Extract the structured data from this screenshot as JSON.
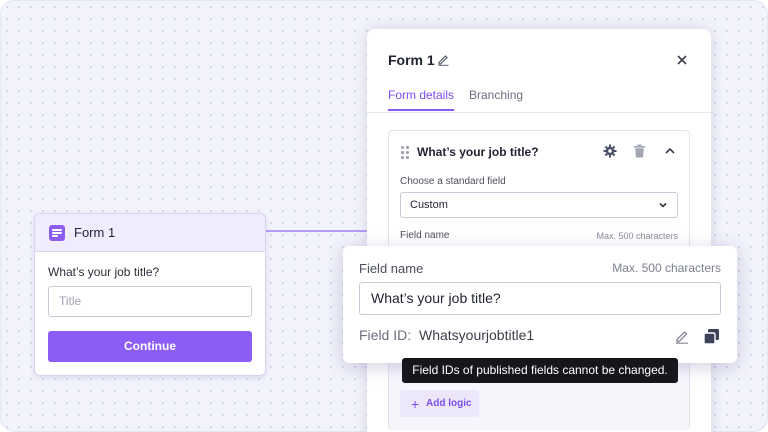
{
  "form_preview": {
    "title": "Form 1",
    "question": "What’s your job title?",
    "input_placeholder": "Title",
    "button_label": "Continue"
  },
  "panel": {
    "title": "Form 1",
    "tabs": [
      {
        "label": "Form details",
        "active": true
      },
      {
        "label": "Branching",
        "active": false
      }
    ],
    "field": {
      "question": "What’s your job title?",
      "standard_field_label": "Choose a standard field",
      "standard_field_value": "Custom",
      "field_name_label": "Field name",
      "field_name_max": "Max. 500 characters",
      "add_logic_label": "Add logic"
    }
  },
  "zoom": {
    "field_name_label": "Field name",
    "field_name_max": "Max. 500 characters",
    "field_name_value": "What’s your job title?",
    "field_id_label": "Field ID:",
    "field_id_value": "Whatsyourjobtitle1"
  },
  "tooltip": {
    "text": "Field IDs of published fields cannot be changed."
  },
  "colors": {
    "accent": "#8b5cf6",
    "canvas_bg": "#f2f3fb",
    "tooltip_bg": "#16171d"
  },
  "icons": [
    "form-icon",
    "pencil-icon",
    "close-icon",
    "drag-handle-icon",
    "gear-icon",
    "trash-icon",
    "chevron-up-icon",
    "chevron-down-icon",
    "plus-icon",
    "copy-icon"
  ]
}
